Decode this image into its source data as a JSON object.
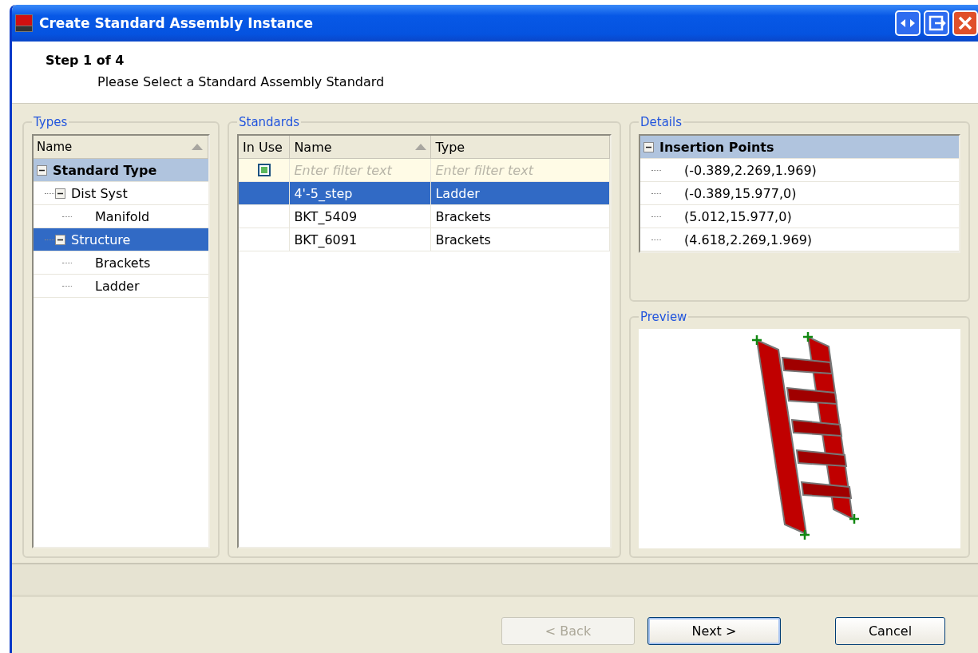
{
  "window": {
    "title": "Create Standard Assembly Instance"
  },
  "header": {
    "step": "Step 1 of 4",
    "instruction": "Please Select a Standard Assembly Standard"
  },
  "types": {
    "legend": "Types",
    "column": {
      "label": "Name",
      "sorted": true
    },
    "tree": [
      {
        "label": "Standard Type",
        "kind": "group",
        "expanded": true,
        "selected": false,
        "children": [
          {
            "label": "Dist Syst",
            "kind": "node",
            "expanded": true,
            "selected": false,
            "children": [
              {
                "label": "Manifold",
                "kind": "leaf",
                "selected": false
              }
            ]
          },
          {
            "label": "Structure",
            "kind": "node",
            "expanded": true,
            "selected": true,
            "children": [
              {
                "label": "Brackets",
                "kind": "leaf",
                "selected": false
              },
              {
                "label": "Ladder",
                "kind": "leaf",
                "selected": false
              }
            ]
          }
        ]
      }
    ]
  },
  "standards": {
    "legend": "Standards",
    "columns": [
      {
        "label": "In Use",
        "sorted": false
      },
      {
        "label": "Name",
        "sorted": true
      },
      {
        "label": "Type",
        "sorted": false
      }
    ],
    "filter": {
      "checked": true,
      "name_placeholder": "Enter filter text",
      "type_placeholder": "Enter filter text"
    },
    "rows": [
      {
        "name": "4'-5_step",
        "type": "Ladder",
        "selected": true
      },
      {
        "name": "BKT_5409",
        "type": "Brackets",
        "selected": false
      },
      {
        "name": "BKT_6091",
        "type": "Brackets",
        "selected": false
      }
    ]
  },
  "details": {
    "legend": "Details",
    "tree": [
      {
        "label": "Insertion Points",
        "kind": "group",
        "expanded": true,
        "selected": false,
        "children": [
          {
            "label": "(-0.389,2.269,1.969)",
            "kind": "leaf",
            "selected": false
          },
          {
            "label": "(-0.389,15.977,0)",
            "kind": "leaf",
            "selected": false
          },
          {
            "label": "(5.012,15.977,0)",
            "kind": "leaf",
            "selected": false
          },
          {
            "label": "(4.618,2.269,1.969)",
            "kind": "leaf",
            "selected": false
          }
        ]
      }
    ]
  },
  "preview": {
    "legend": "Preview"
  },
  "buttons": [
    {
      "label": "< Back",
      "disabled": true,
      "default": false
    },
    {
      "label": "Next >",
      "disabled": false,
      "default": true
    },
    {
      "label": "Cancel",
      "disabled": false,
      "default": false
    }
  ]
}
